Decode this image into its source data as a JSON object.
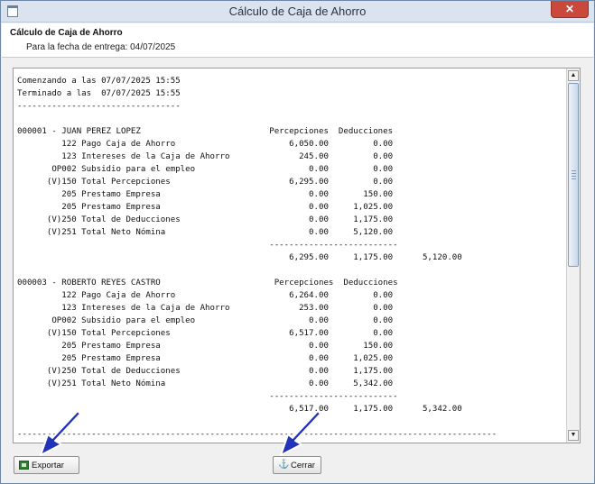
{
  "window": {
    "title": "Cálculo de Caja de Ahorro",
    "close_label": "✕"
  },
  "header": {
    "title": "Cálculo de Caja de Ahorro",
    "subtitle": "Para la fecha de entrega: 04/07/2025"
  },
  "report": {
    "lines": [
      "Comenzando a las 07/07/2025 15:55",
      "Terminado a las  07/07/2025 15:55",
      "---------------------------------",
      "",
      "000001 - JUAN PEREZ LOPEZ                          Percepciones  Deducciones",
      "         122 Pago Caja de Ahorro                       6,050.00         0.00",
      "         123 Intereses de la Caja de Ahorro              245.00         0.00",
      "       OP002 Subsidio para el empleo                       0.00         0.00",
      "      (V)150 Total Percepciones                        6,295.00         0.00",
      "         205 Prestamo Empresa                              0.00       150.00",
      "         205 Prestamo Empresa                              0.00     1,025.00",
      "      (V)250 Total de Deducciones                          0.00     1,175.00",
      "      (V)251 Total Neto Nómina                             0.00     5,120.00",
      "                                                   --------------------------",
      "                                                       6,295.00     1,175.00      5,120.00",
      "",
      "000003 - ROBERTO REYES CASTRO                       Percepciones  Deducciones",
      "         122 Pago Caja de Ahorro                       6,264.00         0.00",
      "         123 Intereses de la Caja de Ahorro              253.00         0.00",
      "       OP002 Subsidio para el empleo                       0.00         0.00",
      "      (V)150 Total Percepciones                        6,517.00         0.00",
      "         205 Prestamo Empresa                              0.00       150.00",
      "         205 Prestamo Empresa                              0.00     1,025.00",
      "      (V)250 Total de Deducciones                          0.00     1,175.00",
      "      (V)251 Total Neto Nómina                             0.00     5,342.00",
      "                                                   --------------------------",
      "                                                       6,517.00     1,175.00      5,342.00",
      "",
      "-------------------------------------------------------------------------------------------------"
    ]
  },
  "buttons": {
    "export_label": "Exportar",
    "close_label": "Cerrar"
  },
  "icons": {
    "export": "excel-icon",
    "close": "anchor-icon",
    "pointer": "arrow-pointer-icon"
  },
  "colors": {
    "titlebar": "#dbe4ee",
    "close": "#c94a3d",
    "pointer": "#2233bb"
  }
}
